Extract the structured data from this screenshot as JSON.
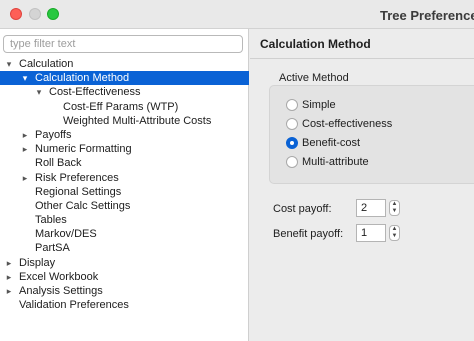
{
  "window": {
    "title": "Tree Preferences"
  },
  "filter": {
    "placeholder": "type filter text",
    "value": ""
  },
  "tree": [
    {
      "label": "Calculation",
      "twisty": "down",
      "selected": false
    },
    {
      "label": "Calculation Method",
      "twisty": "down",
      "selected": true
    },
    {
      "label": "Cost-Effectiveness",
      "twisty": "down",
      "selected": false
    },
    {
      "label": "Cost-Eff Params (WTP)",
      "twisty": "",
      "selected": false
    },
    {
      "label": "Weighted Multi-Attribute Costs",
      "twisty": "",
      "selected": false
    },
    {
      "label": "Payoffs",
      "twisty": "right",
      "selected": false
    },
    {
      "label": "Numeric Formatting",
      "twisty": "right",
      "selected": false
    },
    {
      "label": "Roll Back",
      "twisty": "",
      "selected": false
    },
    {
      "label": "Risk Preferences",
      "twisty": "right",
      "selected": false
    },
    {
      "label": "Regional Settings",
      "twisty": "",
      "selected": false
    },
    {
      "label": "Other Calc Settings",
      "twisty": "",
      "selected": false
    },
    {
      "label": "Tables",
      "twisty": "",
      "selected": false
    },
    {
      "label": "Markov/DES",
      "twisty": "",
      "selected": false
    },
    {
      "label": "PartSA",
      "twisty": "",
      "selected": false
    },
    {
      "label": "Display",
      "twisty": "right",
      "selected": false
    },
    {
      "label": "Excel Workbook",
      "twisty": "right",
      "selected": false
    },
    {
      "label": "Analysis Settings",
      "twisty": "right",
      "selected": false
    },
    {
      "label": "Validation Preferences",
      "twisty": "",
      "selected": false
    }
  ],
  "icons": {
    "twisty_down": "chevron-down-icon",
    "twisty_right": "chevron-right-icon",
    "stepper": "stepper-icon"
  },
  "colors": {
    "selection": "#0a62d5",
    "radio_selected": "#0a62d5"
  },
  "panel": {
    "title": "Calculation Method",
    "active_method": {
      "label": "Active Method",
      "options": [
        "Simple",
        "Cost-effectiveness",
        "Benefit-cost",
        "Multi-attribute"
      ],
      "selected": "Benefit-cost"
    },
    "cost_payoff": {
      "label": "Cost payoff:",
      "value": "2"
    },
    "benefit_payoff": {
      "label": "Benefit payoff:",
      "value": "1"
    }
  }
}
